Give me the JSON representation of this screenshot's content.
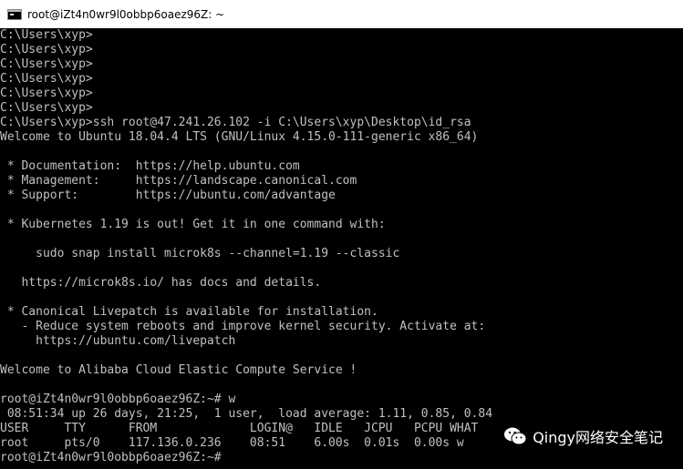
{
  "window": {
    "title": "root@iZt4n0wr9l0obbp6oaez96Z: ~",
    "icon": "console-icon"
  },
  "console": {
    "lines": [
      "C:\\Users\\xyp>",
      "C:\\Users\\xyp>",
      "C:\\Users\\xyp>",
      "C:\\Users\\xyp>",
      "C:\\Users\\xyp>",
      "C:\\Users\\xyp>",
      "C:\\Users\\xyp>ssh root@47.241.26.102 -i C:\\Users\\xyp\\Desktop\\id_rsa",
      "Welcome to Ubuntu 18.04.4 LTS (GNU/Linux 4.15.0-111-generic x86_64)",
      "",
      " * Documentation:  https://help.ubuntu.com",
      " * Management:     https://landscape.canonical.com",
      " * Support:        https://ubuntu.com/advantage",
      "",
      " * Kubernetes 1.19 is out! Get it in one command with:",
      "",
      "     sudo snap install microk8s --channel=1.19 --classic",
      "",
      "   https://microk8s.io/ has docs and details.",
      "",
      " * Canonical Livepatch is available for installation.",
      "   - Reduce system reboots and improve kernel security. Activate at:",
      "     https://ubuntu.com/livepatch",
      "",
      "Welcome to Alibaba Cloud Elastic Compute Service !",
      "",
      "root@iZt4n0wr9l0obbp6oaez96Z:~# w",
      " 08:51:34 up 26 days, 21:25,  1 user,  load average: 1.11, 0.85, 0.84",
      "USER     TTY      FROM             LOGIN@   IDLE   JCPU   PCPU WHAT",
      "root     pts/0    117.136.0.236    08:51    6.00s  0.01s  0.00s w",
      "root@iZt4n0wr9l0obbp6oaez96Z:~# "
    ]
  },
  "watermark": {
    "text": "Qingy网络安全笔记",
    "icon": "wechat-icon"
  },
  "colors": {
    "console_bg": "#000000",
    "console_fg": "#c0c0c0",
    "titlebar_bg": "#ffffff"
  }
}
